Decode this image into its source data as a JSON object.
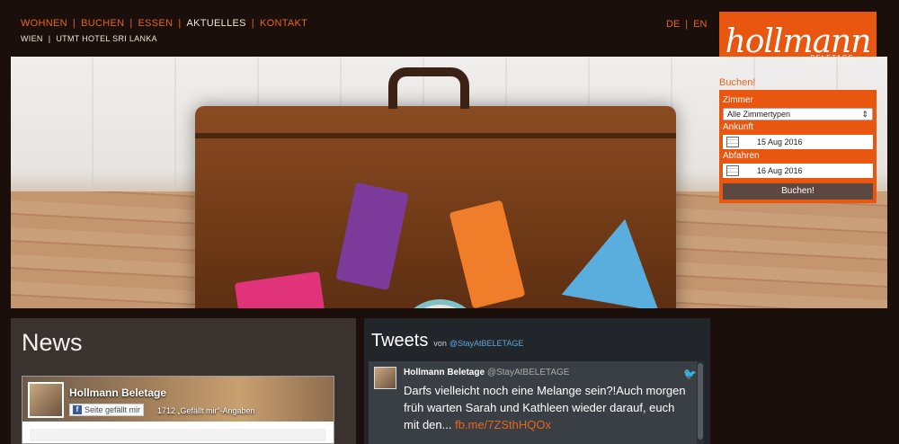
{
  "nav": {
    "primary": [
      {
        "label": "WOHNEN",
        "active": false
      },
      {
        "label": "BUCHEN",
        "active": false
      },
      {
        "label": "ESSEN",
        "active": false
      },
      {
        "label": "AKTUELLES",
        "active": true
      },
      {
        "label": "KONTAKT",
        "active": false
      }
    ],
    "secondary": [
      "WIEN",
      "UTMT HOTEL SRI LANKA"
    ],
    "languages": [
      "DE",
      "EN"
    ]
  },
  "logo": {
    "script": "hollmann",
    "sub": "BELETAGE"
  },
  "booking": {
    "title": "Buchen!",
    "room_label": "Zimmer",
    "room_value": "Alle Zimmertypen",
    "arrival_label": "Ankunft",
    "arrival_value": "15 Aug 2016",
    "departure_label": "Abfahren",
    "departure_value": "16 Aug 2016",
    "submit_label": "Buchen!"
  },
  "news": {
    "title": "News",
    "facebook": {
      "page_name": "Hollmann Beletage",
      "like_label": "Seite gefällt mir",
      "like_count": "1712 „Gefällt mir“-Angaben"
    }
  },
  "tweets": {
    "title": "Tweets",
    "by_label": "von",
    "handle": "@StayAtBELETAGE",
    "tweet": {
      "author": "Hollmann Beletage",
      "author_handle": "@StayAtBELETAGE",
      "text": "Darfs vielleicht noch eine Melange sein?!Auch morgen früh warten Sarah und Kathleen wieder darauf, euch mit den...",
      "link": "fb.me/7ZSthHQOx"
    }
  },
  "colors": {
    "accent": "#e8641e",
    "logo_bg": "#e8560f",
    "page_bg": "#1a0f0b"
  },
  "icons": [
    "calendar-icon",
    "twitter-bird-icon",
    "facebook-icon",
    "select-arrows-icon"
  ]
}
